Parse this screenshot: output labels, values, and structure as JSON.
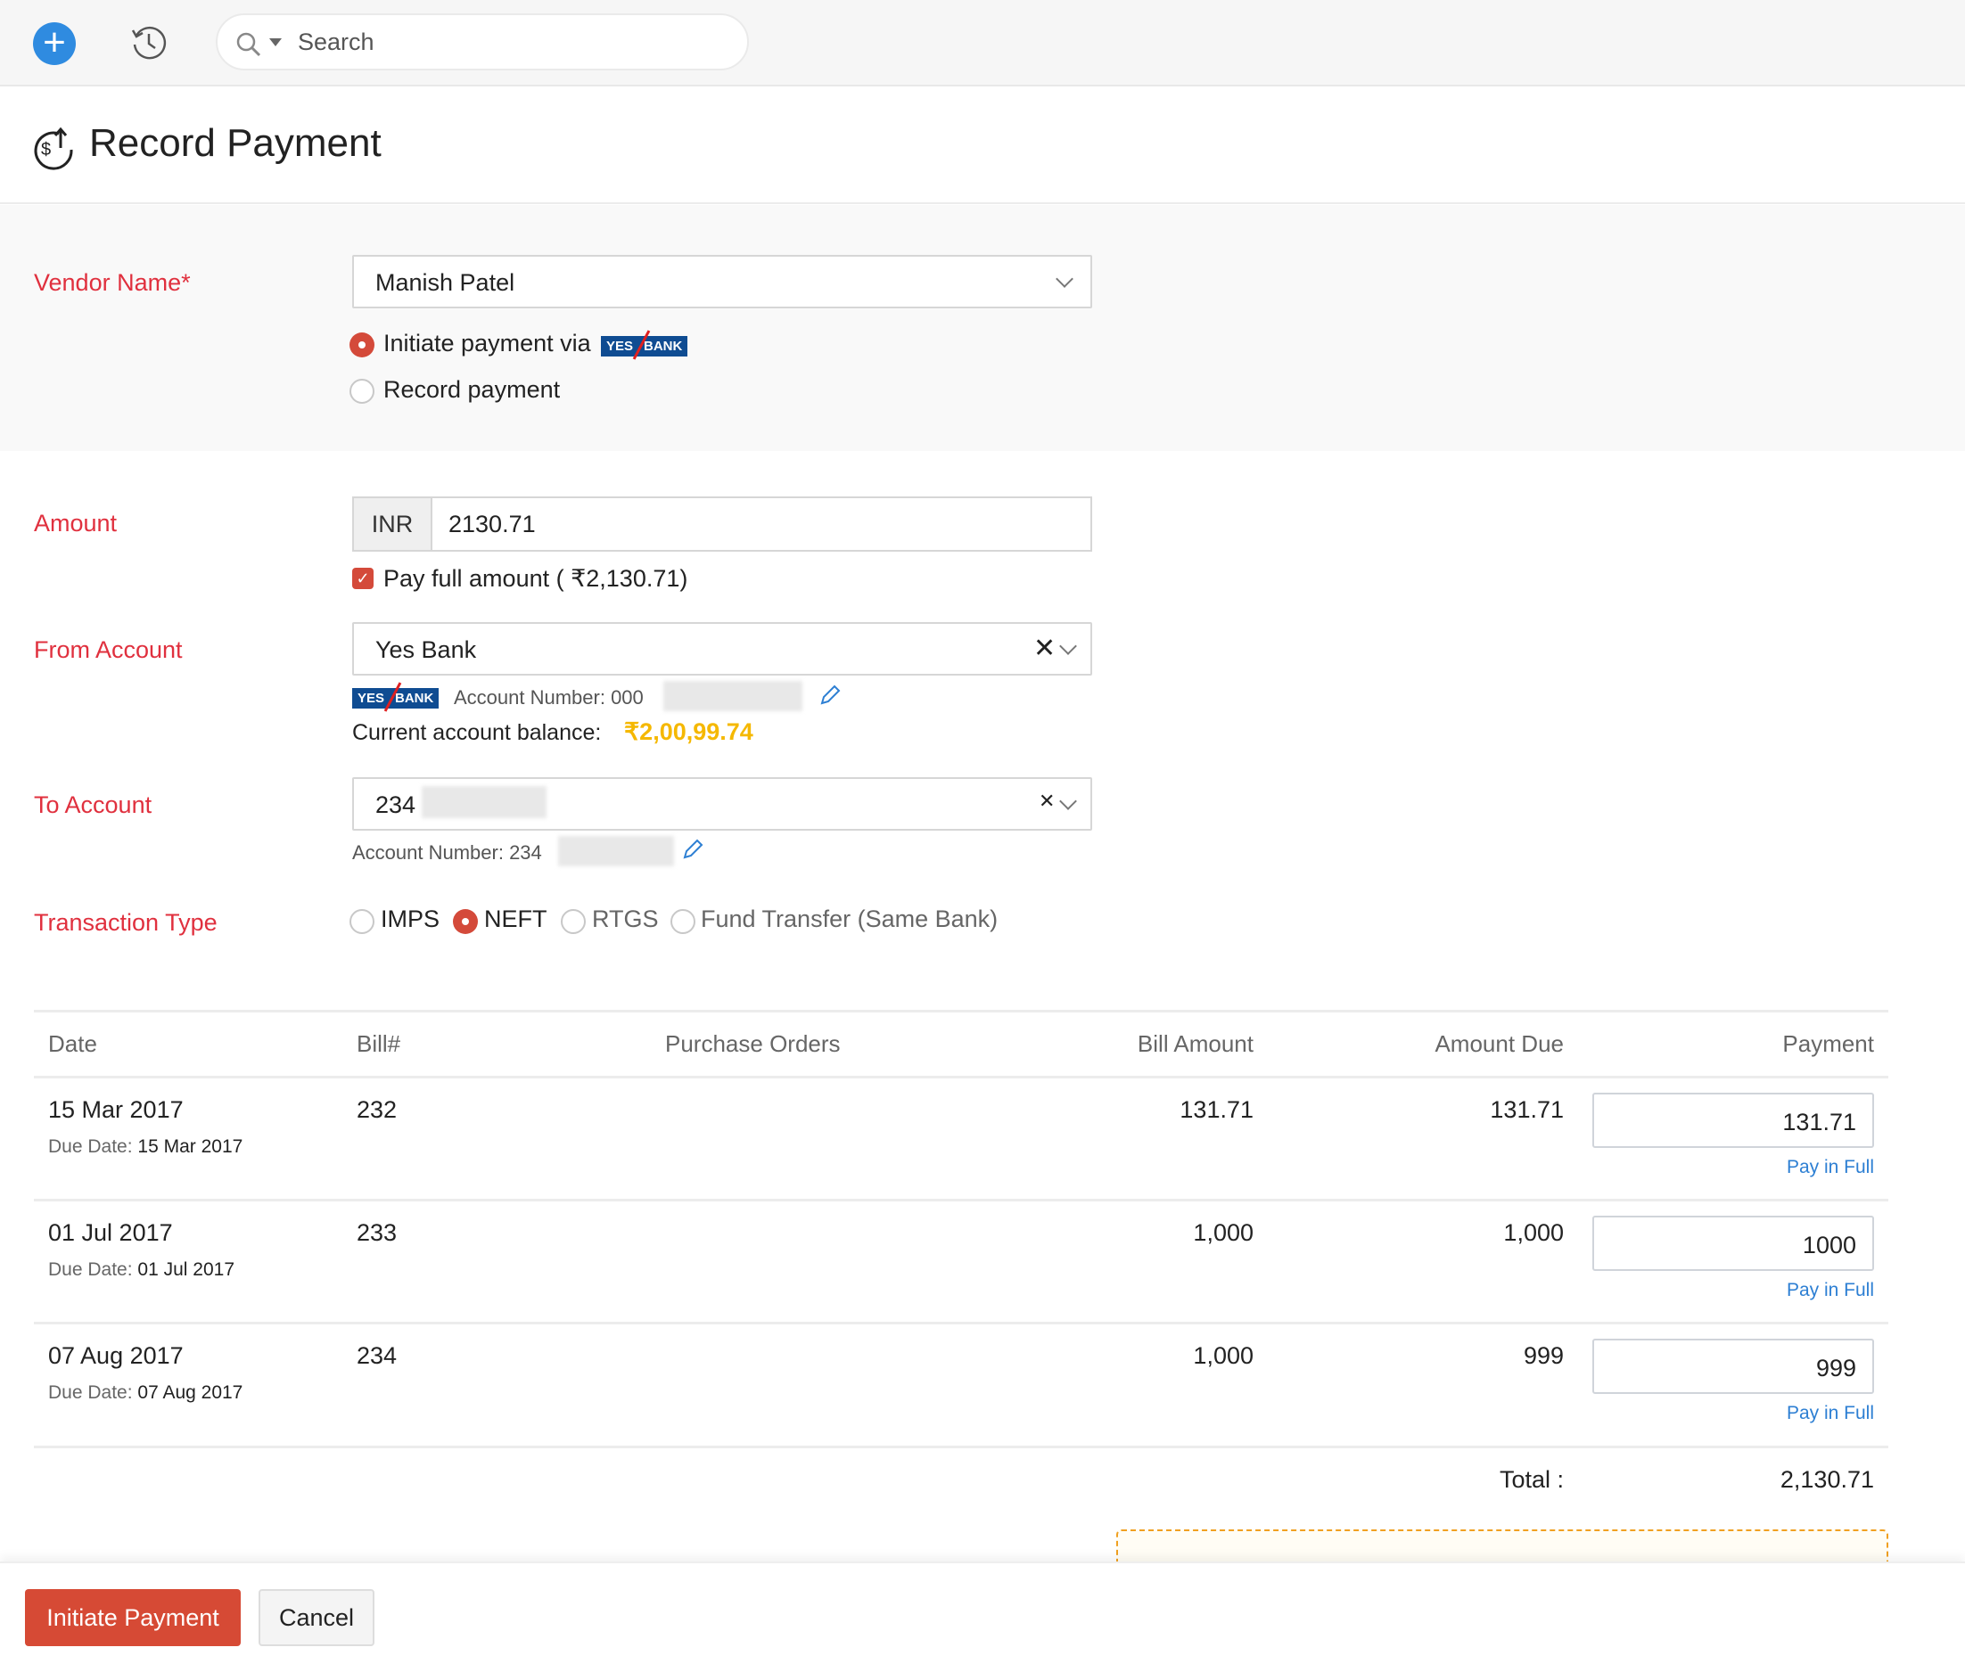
{
  "topbar": {
    "search_placeholder": "Search"
  },
  "page": {
    "title": "Record Payment"
  },
  "vendor": {
    "label": "Vendor Name*",
    "value": "Manish Patel",
    "options": [
      {
        "label": "Initiate payment via",
        "selected": true,
        "bank_logo": {
          "left": "YES",
          "right": "BANK"
        }
      },
      {
        "label": "Record payment",
        "selected": false
      }
    ]
  },
  "amount": {
    "label": "Amount",
    "currency": "INR",
    "value": "2130.71",
    "pay_full_label": "Pay full amount ( ₹2,130.71)",
    "pay_full_checked": true
  },
  "from_account": {
    "label": "From Account",
    "value": "Yes Bank",
    "account_number_label": "Account Number: 000",
    "balance_label": "Current account balance:",
    "balance_value": "₹2,00,99.74",
    "bank_logo": {
      "left": "YES",
      "right": "BANK"
    }
  },
  "to_account": {
    "label": "To Account",
    "value": "234",
    "account_number_label": "Account Number: 234"
  },
  "transaction_type": {
    "label": "Transaction Type",
    "options": [
      {
        "label": "IMPS",
        "selected": false
      },
      {
        "label": "NEFT",
        "selected": true
      },
      {
        "label": "RTGS",
        "selected": false
      },
      {
        "label": "Fund Transfer (Same Bank)",
        "selected": false
      }
    ]
  },
  "table": {
    "headers": [
      "Date",
      "Bill#",
      "Purchase Orders",
      "Bill Amount",
      "Amount Due",
      "Payment"
    ],
    "due_label": "Due Date:",
    "pay_in_full": "Pay in Full",
    "rows": [
      {
        "date": "15 Mar 2017",
        "due_date": "15 Mar 2017",
        "bill": "232",
        "po": "",
        "bill_amount": "131.71",
        "amount_due": "131.71",
        "payment": "131.71"
      },
      {
        "date": "01 Jul 2017",
        "due_date": "01 Jul 2017",
        "bill": "233",
        "po": "",
        "bill_amount": "1,000",
        "amount_due": "1,000",
        "payment": "1000"
      },
      {
        "date": "07 Aug 2017",
        "due_date": "07 Aug 2017",
        "bill": "234",
        "po": "",
        "bill_amount": "1,000",
        "amount_due": "999",
        "payment": "999"
      }
    ],
    "total_label": "Total :",
    "total_value": "2,130.71"
  },
  "footer": {
    "primary": "Initiate Payment",
    "cancel": "Cancel"
  }
}
